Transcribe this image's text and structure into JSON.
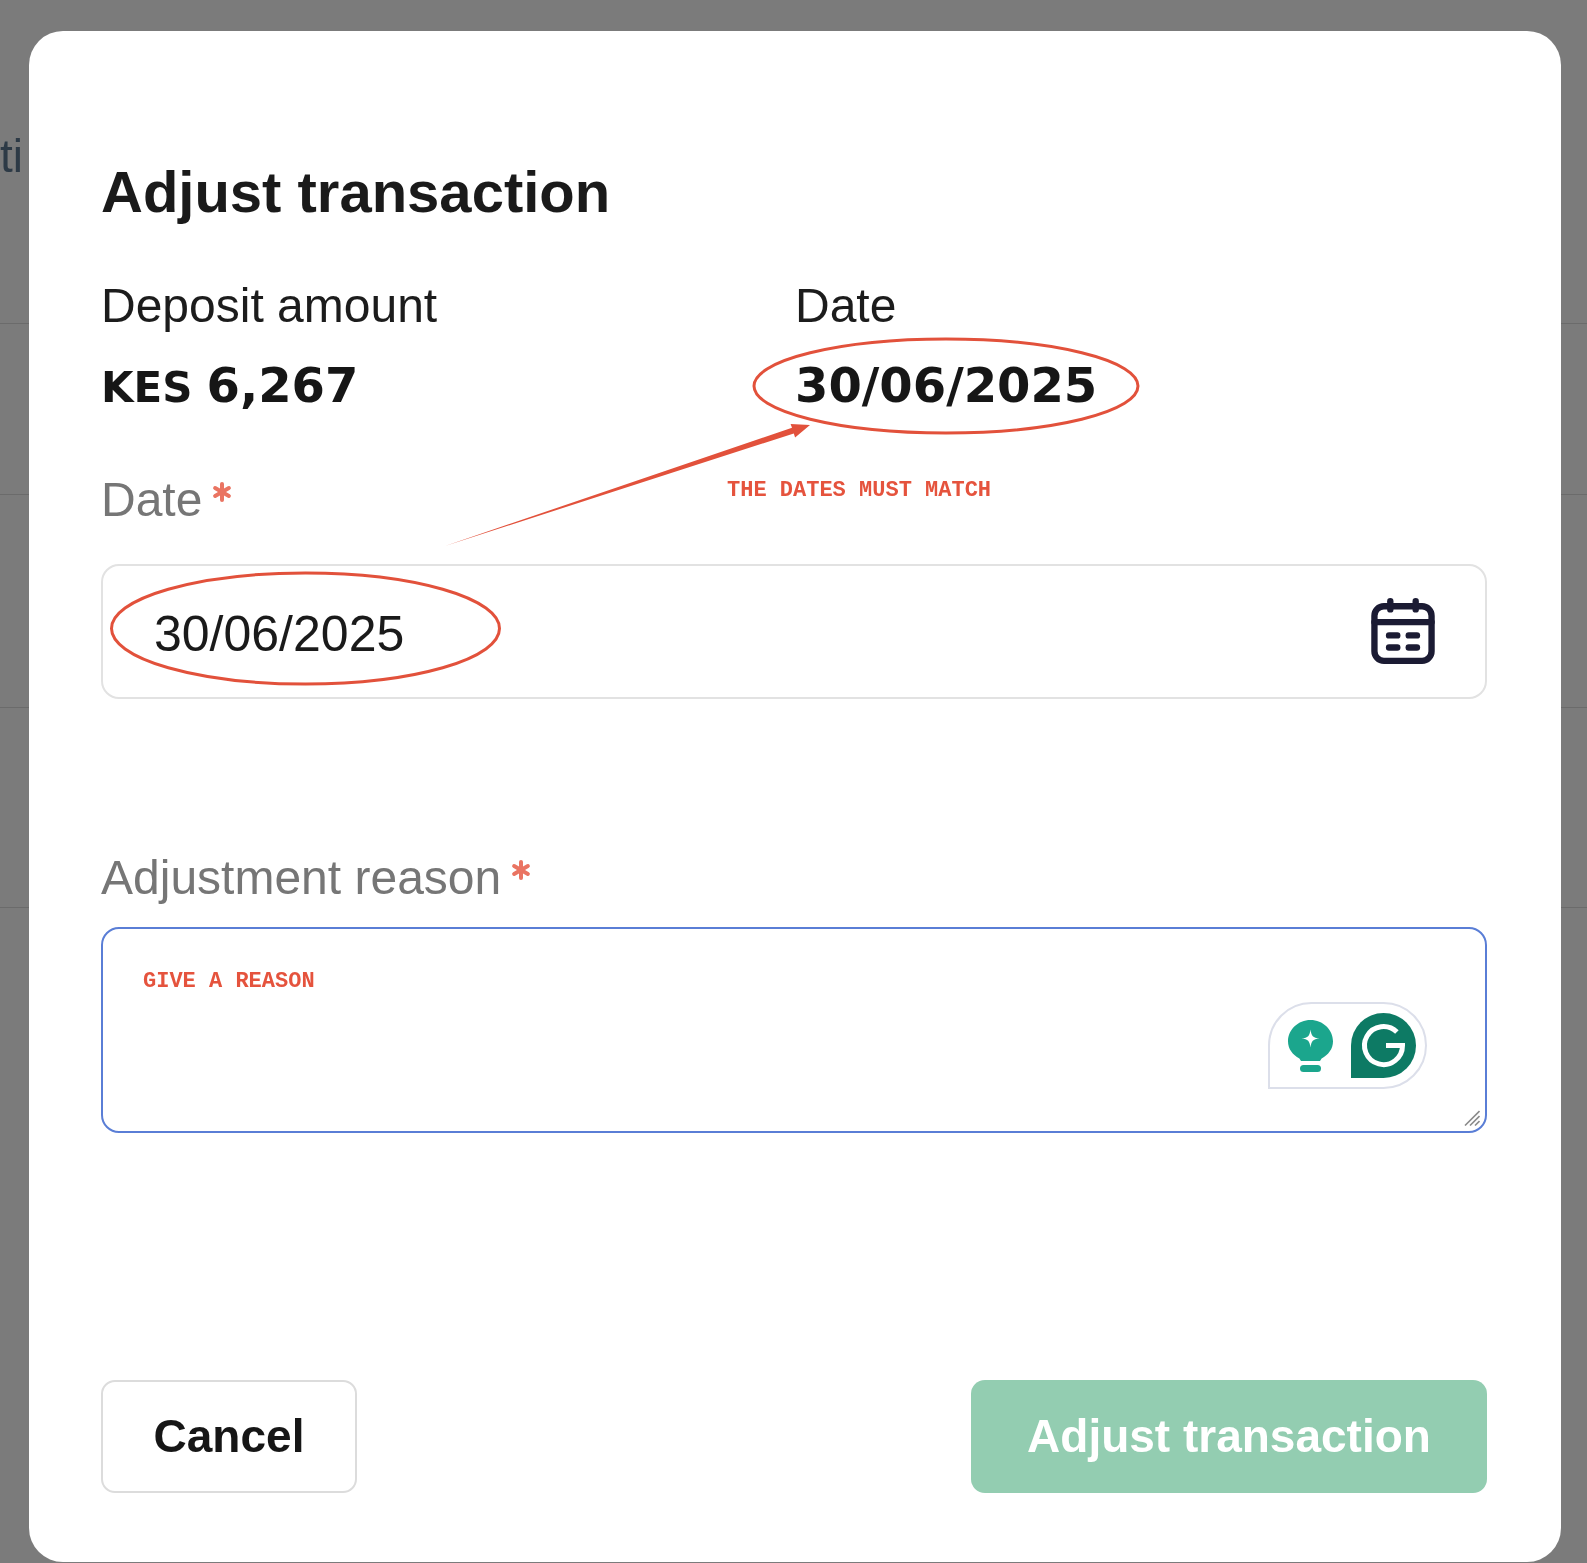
{
  "background_page": {
    "heading_fragment": "ti"
  },
  "dialog": {
    "title": "Adjust transaction",
    "summary": [
      {
        "label": "Deposit amount",
        "prefix": "KES",
        "value": "6,267"
      },
      {
        "label": "Date",
        "value": "30/06/2025"
      }
    ],
    "date_field": {
      "label": "Date",
      "required": true,
      "value": "30/06/2025"
    },
    "reason_field": {
      "label": "Adjustment reason",
      "required": true,
      "focused": true
    },
    "buttons": [
      {
        "label": "Cancel",
        "kind": "secondary",
        "disabled": false
      },
      {
        "label": "Adjust transaction",
        "kind": "primary",
        "disabled": true
      }
    ]
  },
  "annotations": {
    "date_note": "THE DATES MUST MATCH",
    "reason_note": "GIVE A REASON"
  }
}
